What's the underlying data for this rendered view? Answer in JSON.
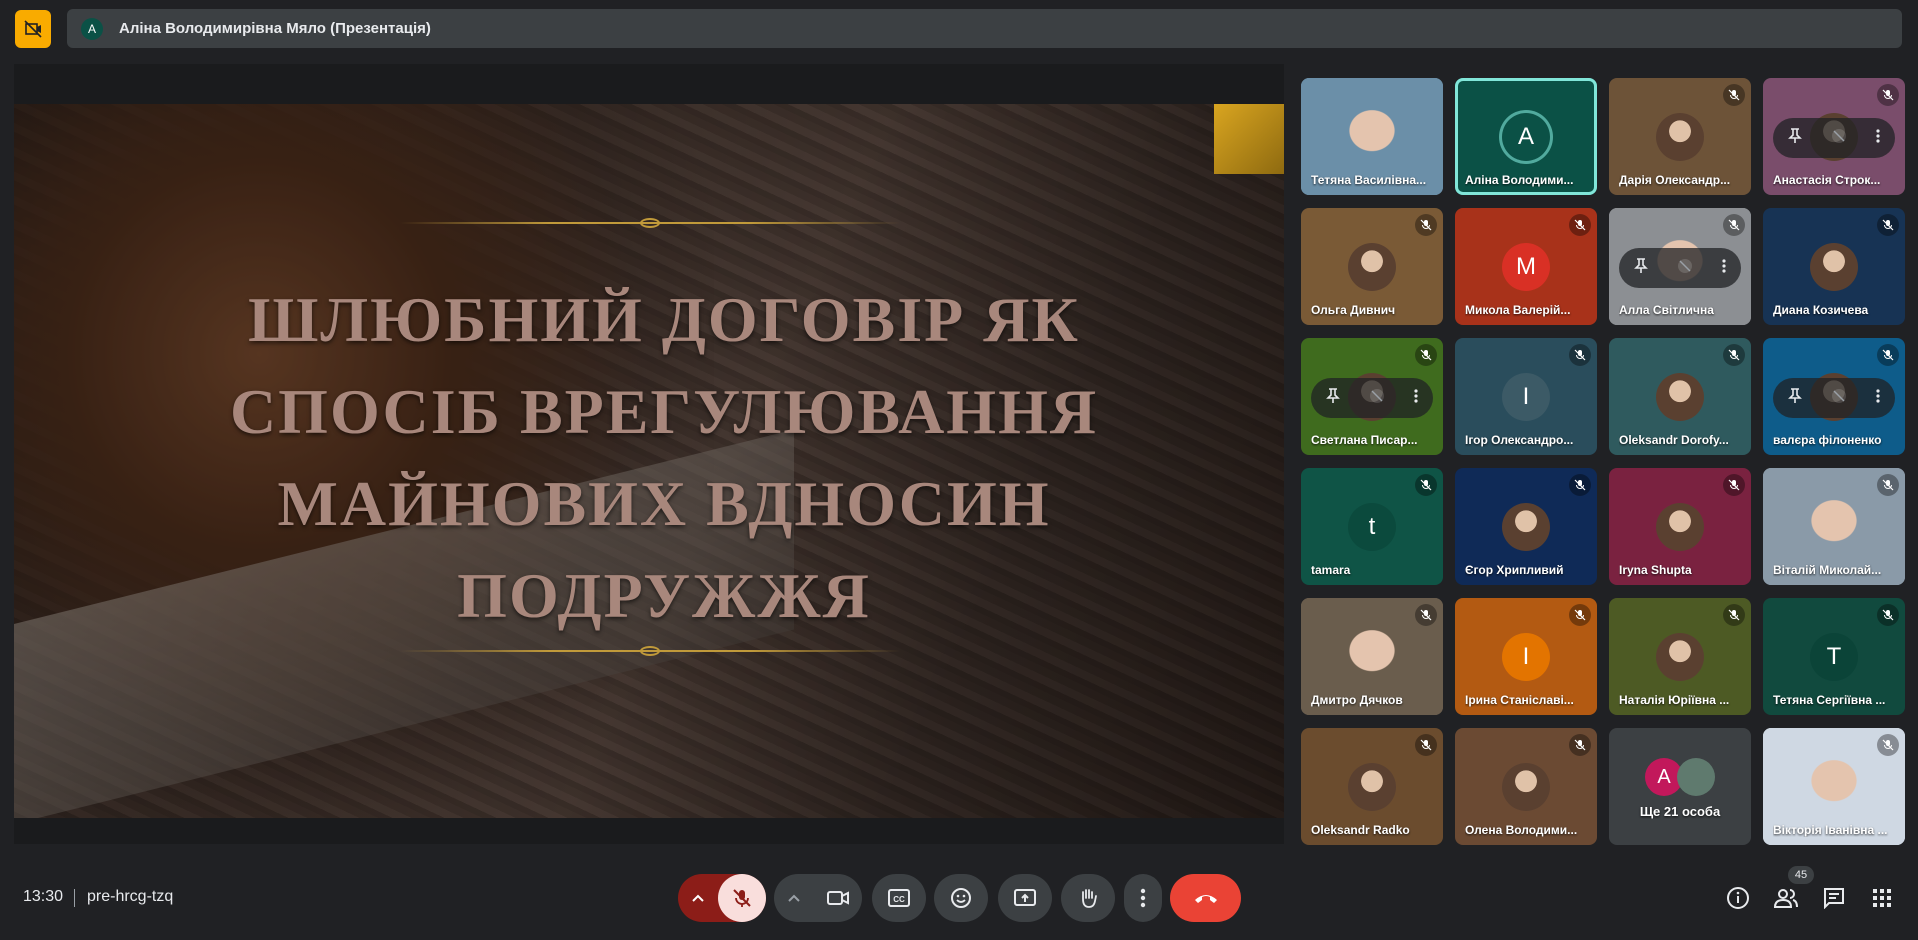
{
  "presenter": {
    "initial": "A",
    "name": "Аліна Володимирівна Мяло (Презентація)"
  },
  "slide": {
    "title_lines": [
      "ШЛЮБНИЙ ДОГОВІР ЯК",
      "СПОСІБ ВРЕГУЛЮВАННЯ",
      "МАЙНОВИХ ВДНОСИН",
      "ПОДРУЖЖЯ"
    ]
  },
  "participants": [
    {
      "name": "Тетяна Василівна...",
      "bg": "#6b8fa8",
      "photo": true
    },
    {
      "name": "Аліна Володими...",
      "bg": "#0b5146",
      "initial": "A",
      "speaking": true
    },
    {
      "name": "Дарія Олександр...",
      "bg": "#6d5338",
      "photo": true
    },
    {
      "name": "Анастасія Строк...",
      "bg": "#7a4d6b",
      "photo": true
    },
    {
      "name": "Ольга Дивнич",
      "bg": "#7a5a36",
      "photo": true
    },
    {
      "name": "Микола Валерій...",
      "bg": "#a8321a",
      "initial": "M",
      "avatar_bg": "#d93025"
    },
    {
      "name": "Алла Світлична",
      "bg": "#8c8f93",
      "photo": true
    },
    {
      "name": "Диана Козичева",
      "bg": "#173354",
      "photo": true
    },
    {
      "name": "Светлана Писар...",
      "bg": "#3f6b1e",
      "photo": true
    },
    {
      "name": "Ігор Олександро...",
      "bg": "#2a4d5c",
      "initial": "I",
      "avatar_bg": "#3c5a66"
    },
    {
      "name": "Oleksandr Dorofy...",
      "bg": "#2f5a5e",
      "photo": true
    },
    {
      "name": "валєра філоненко",
      "bg": "#0e5c8a",
      "photo": true
    },
    {
      "name": "tamara",
      "bg": "#0f5446",
      "initial": "t",
      "avatar_bg": "#0b4a3d"
    },
    {
      "name": "Єгор Хрипливий",
      "bg": "#0f2a57",
      "photo": true
    },
    {
      "name": "Iryna Shupta",
      "bg": "#7a2240",
      "photo": true
    },
    {
      "name": "Віталій Миколай...",
      "bg": "#8a9aa8",
      "photo": true
    },
    {
      "name": "Дмитро Дячков",
      "bg": "#6a5d4d",
      "photo": true
    },
    {
      "name": "Ірина Станіславі...",
      "bg": "#b35a12",
      "initial": "I",
      "avatar_bg": "#e37400"
    },
    {
      "name": "Наталія Юріївна ...",
      "bg": "#4d5a24",
      "photo": true
    },
    {
      "name": "Тетяна Сергіївна ...",
      "bg": "#114a3e",
      "initial": "T",
      "avatar_bg": "#0b4438"
    },
    {
      "name": "Oleksandr Radko",
      "bg": "#6b4c2e",
      "photo": true
    },
    {
      "name": "Олена Володими...",
      "bg": "#6b4a33",
      "photo": true
    },
    {
      "name": "Ще 21 особа",
      "bg": "#3c4043",
      "more": true
    },
    {
      "name": "Вікторія Іванівна ...",
      "bg": "#cfd8e3",
      "photo": true
    }
  ],
  "more_avatar_initial": "A",
  "bottom": {
    "time": "13:30",
    "meeting_code": "pre-hrcg-tzq",
    "participant_count": "45"
  },
  "colors": {
    "end_call": "#ea4335",
    "mic_off": "#f9dedc",
    "accent": "#81e6d9"
  }
}
